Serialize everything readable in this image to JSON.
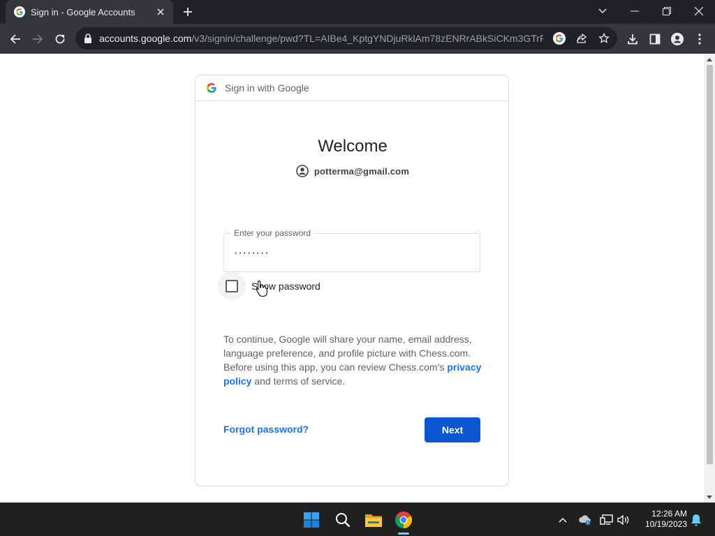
{
  "browser": {
    "tab": {
      "title": "Sign in - Google Accounts",
      "favicon": "google-g-icon"
    },
    "address": {
      "host": "accounts.google.com",
      "path": "/v3/signin/challenge/pwd?TL=AIBe4_KptgYNDjuRklAm78zENRrABkSiCKm3GTrF..."
    }
  },
  "page": {
    "header_text": "Sign in with Google",
    "welcome": "Welcome",
    "email": "potterma@gmail.com",
    "password_label": "Enter your password",
    "password_value": "········",
    "show_password_label": "Show password",
    "show_password_checked": false,
    "consent_text_1": "To continue, Google will share your name, email address, language preference, and profile picture with Chess.com. Before using this app, you can review Chess.com’s ",
    "privacy_link": "privacy policy",
    "consent_text_2": " and terms of service.",
    "forgot_label": "Forgot password?",
    "next_label": "Next"
  },
  "taskbar": {
    "time": "12:26 AM",
    "date": "10/19/2023"
  },
  "colors": {
    "accent": "#1a73e8",
    "next_button": "#0b57d0",
    "chrome_dark": "#202124"
  }
}
